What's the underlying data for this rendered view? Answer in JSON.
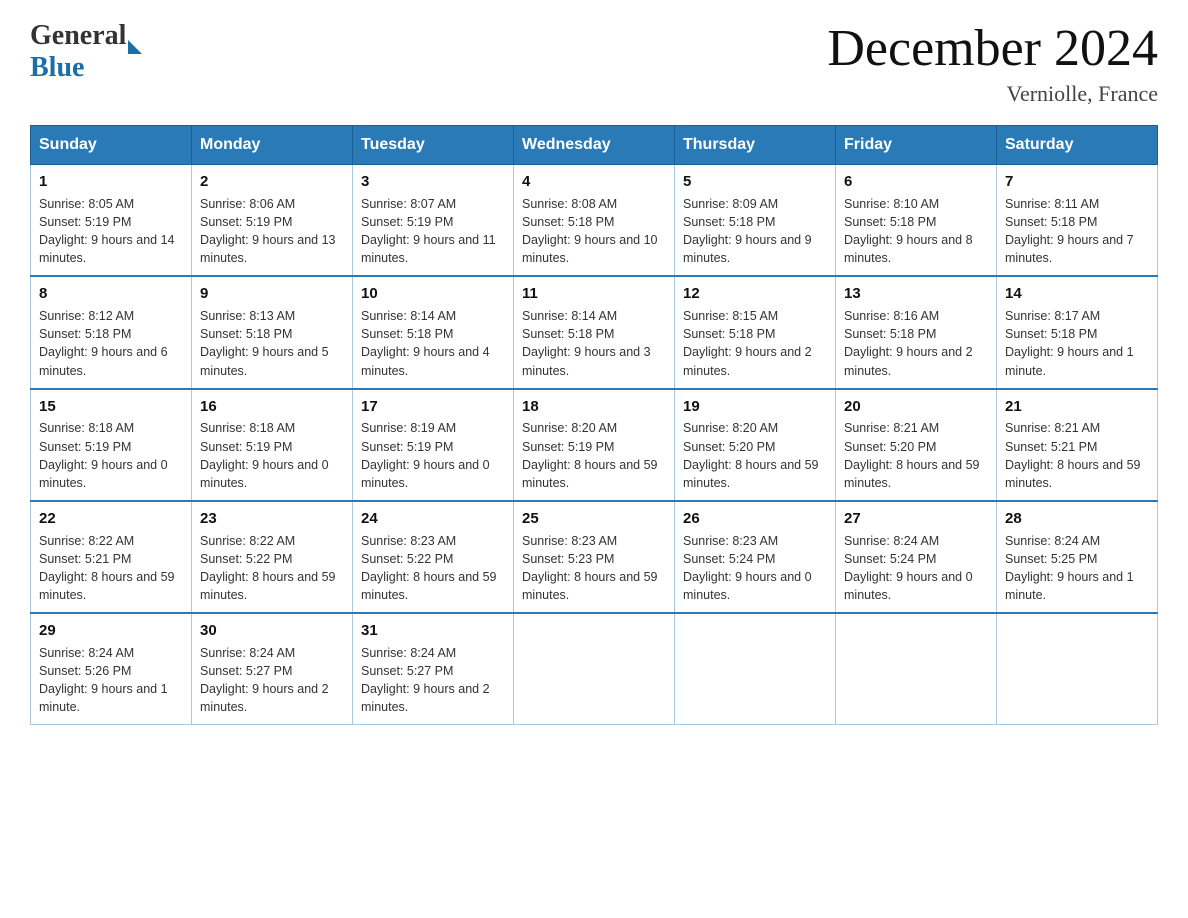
{
  "header": {
    "logo_general": "General",
    "logo_blue": "Blue",
    "month_title": "December 2024",
    "location": "Verniolle, France"
  },
  "days_of_week": [
    "Sunday",
    "Monday",
    "Tuesday",
    "Wednesday",
    "Thursday",
    "Friday",
    "Saturday"
  ],
  "weeks": [
    [
      {
        "day": "1",
        "sunrise": "Sunrise: 8:05 AM",
        "sunset": "Sunset: 5:19 PM",
        "daylight": "Daylight: 9 hours and 14 minutes."
      },
      {
        "day": "2",
        "sunrise": "Sunrise: 8:06 AM",
        "sunset": "Sunset: 5:19 PM",
        "daylight": "Daylight: 9 hours and 13 minutes."
      },
      {
        "day": "3",
        "sunrise": "Sunrise: 8:07 AM",
        "sunset": "Sunset: 5:19 PM",
        "daylight": "Daylight: 9 hours and 11 minutes."
      },
      {
        "day": "4",
        "sunrise": "Sunrise: 8:08 AM",
        "sunset": "Sunset: 5:18 PM",
        "daylight": "Daylight: 9 hours and 10 minutes."
      },
      {
        "day": "5",
        "sunrise": "Sunrise: 8:09 AM",
        "sunset": "Sunset: 5:18 PM",
        "daylight": "Daylight: 9 hours and 9 minutes."
      },
      {
        "day": "6",
        "sunrise": "Sunrise: 8:10 AM",
        "sunset": "Sunset: 5:18 PM",
        "daylight": "Daylight: 9 hours and 8 minutes."
      },
      {
        "day": "7",
        "sunrise": "Sunrise: 8:11 AM",
        "sunset": "Sunset: 5:18 PM",
        "daylight": "Daylight: 9 hours and 7 minutes."
      }
    ],
    [
      {
        "day": "8",
        "sunrise": "Sunrise: 8:12 AM",
        "sunset": "Sunset: 5:18 PM",
        "daylight": "Daylight: 9 hours and 6 minutes."
      },
      {
        "day": "9",
        "sunrise": "Sunrise: 8:13 AM",
        "sunset": "Sunset: 5:18 PM",
        "daylight": "Daylight: 9 hours and 5 minutes."
      },
      {
        "day": "10",
        "sunrise": "Sunrise: 8:14 AM",
        "sunset": "Sunset: 5:18 PM",
        "daylight": "Daylight: 9 hours and 4 minutes."
      },
      {
        "day": "11",
        "sunrise": "Sunrise: 8:14 AM",
        "sunset": "Sunset: 5:18 PM",
        "daylight": "Daylight: 9 hours and 3 minutes."
      },
      {
        "day": "12",
        "sunrise": "Sunrise: 8:15 AM",
        "sunset": "Sunset: 5:18 PM",
        "daylight": "Daylight: 9 hours and 2 minutes."
      },
      {
        "day": "13",
        "sunrise": "Sunrise: 8:16 AM",
        "sunset": "Sunset: 5:18 PM",
        "daylight": "Daylight: 9 hours and 2 minutes."
      },
      {
        "day": "14",
        "sunrise": "Sunrise: 8:17 AM",
        "sunset": "Sunset: 5:18 PM",
        "daylight": "Daylight: 9 hours and 1 minute."
      }
    ],
    [
      {
        "day": "15",
        "sunrise": "Sunrise: 8:18 AM",
        "sunset": "Sunset: 5:19 PM",
        "daylight": "Daylight: 9 hours and 0 minutes."
      },
      {
        "day": "16",
        "sunrise": "Sunrise: 8:18 AM",
        "sunset": "Sunset: 5:19 PM",
        "daylight": "Daylight: 9 hours and 0 minutes."
      },
      {
        "day": "17",
        "sunrise": "Sunrise: 8:19 AM",
        "sunset": "Sunset: 5:19 PM",
        "daylight": "Daylight: 9 hours and 0 minutes."
      },
      {
        "day": "18",
        "sunrise": "Sunrise: 8:20 AM",
        "sunset": "Sunset: 5:19 PM",
        "daylight": "Daylight: 8 hours and 59 minutes."
      },
      {
        "day": "19",
        "sunrise": "Sunrise: 8:20 AM",
        "sunset": "Sunset: 5:20 PM",
        "daylight": "Daylight: 8 hours and 59 minutes."
      },
      {
        "day": "20",
        "sunrise": "Sunrise: 8:21 AM",
        "sunset": "Sunset: 5:20 PM",
        "daylight": "Daylight: 8 hours and 59 minutes."
      },
      {
        "day": "21",
        "sunrise": "Sunrise: 8:21 AM",
        "sunset": "Sunset: 5:21 PM",
        "daylight": "Daylight: 8 hours and 59 minutes."
      }
    ],
    [
      {
        "day": "22",
        "sunrise": "Sunrise: 8:22 AM",
        "sunset": "Sunset: 5:21 PM",
        "daylight": "Daylight: 8 hours and 59 minutes."
      },
      {
        "day": "23",
        "sunrise": "Sunrise: 8:22 AM",
        "sunset": "Sunset: 5:22 PM",
        "daylight": "Daylight: 8 hours and 59 minutes."
      },
      {
        "day": "24",
        "sunrise": "Sunrise: 8:23 AM",
        "sunset": "Sunset: 5:22 PM",
        "daylight": "Daylight: 8 hours and 59 minutes."
      },
      {
        "day": "25",
        "sunrise": "Sunrise: 8:23 AM",
        "sunset": "Sunset: 5:23 PM",
        "daylight": "Daylight: 8 hours and 59 minutes."
      },
      {
        "day": "26",
        "sunrise": "Sunrise: 8:23 AM",
        "sunset": "Sunset: 5:24 PM",
        "daylight": "Daylight: 9 hours and 0 minutes."
      },
      {
        "day": "27",
        "sunrise": "Sunrise: 8:24 AM",
        "sunset": "Sunset: 5:24 PM",
        "daylight": "Daylight: 9 hours and 0 minutes."
      },
      {
        "day": "28",
        "sunrise": "Sunrise: 8:24 AM",
        "sunset": "Sunset: 5:25 PM",
        "daylight": "Daylight: 9 hours and 1 minute."
      }
    ],
    [
      {
        "day": "29",
        "sunrise": "Sunrise: 8:24 AM",
        "sunset": "Sunset: 5:26 PM",
        "daylight": "Daylight: 9 hours and 1 minute."
      },
      {
        "day": "30",
        "sunrise": "Sunrise: 8:24 AM",
        "sunset": "Sunset: 5:27 PM",
        "daylight": "Daylight: 9 hours and 2 minutes."
      },
      {
        "day": "31",
        "sunrise": "Sunrise: 8:24 AM",
        "sunset": "Sunset: 5:27 PM",
        "daylight": "Daylight: 9 hours and 2 minutes."
      },
      null,
      null,
      null,
      null
    ]
  ]
}
